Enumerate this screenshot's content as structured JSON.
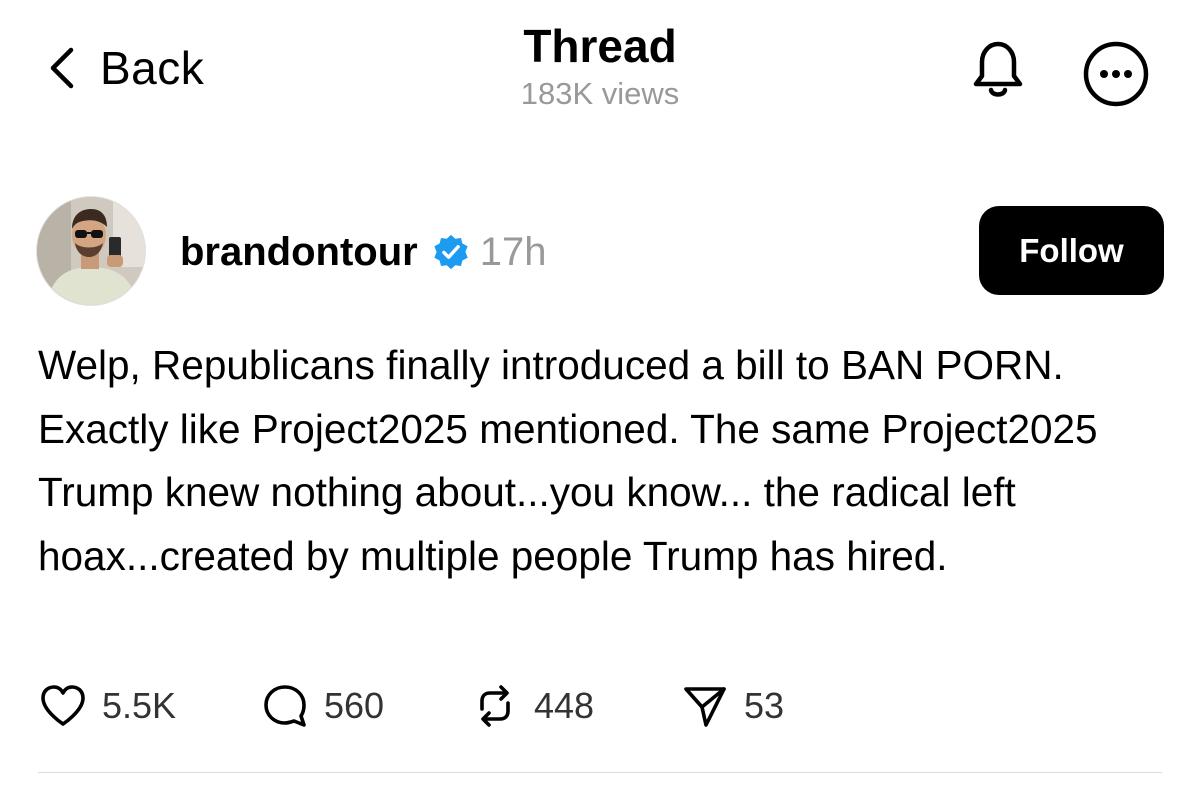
{
  "nav": {
    "back_label": "Back",
    "title": "Thread",
    "subtitle": "183K views",
    "icons": [
      "chevron-left-icon",
      "bell-icon",
      "more-icon"
    ]
  },
  "post": {
    "author": {
      "username": "brandontour",
      "verified": true,
      "time": "17h"
    },
    "follow_label": "Follow",
    "text": "Welp, Republicans finally introduced a bill to BAN PORN. Exactly like Project2025 mentioned. The same Project2025 Trump knew nothing about...you know... the radical left hoax...created by multiple people Trump has hired.",
    "stats": {
      "likes": "5.5K",
      "replies": "560",
      "reposts": "448",
      "shares": "53"
    }
  },
  "colors": {
    "text": "#000000",
    "secondary_text": "#999999",
    "verified_blue": "#1D9BF0",
    "follow_button_bg": "#000000",
    "follow_button_text": "#FFFFFF",
    "divider": "#DCDCDC"
  }
}
